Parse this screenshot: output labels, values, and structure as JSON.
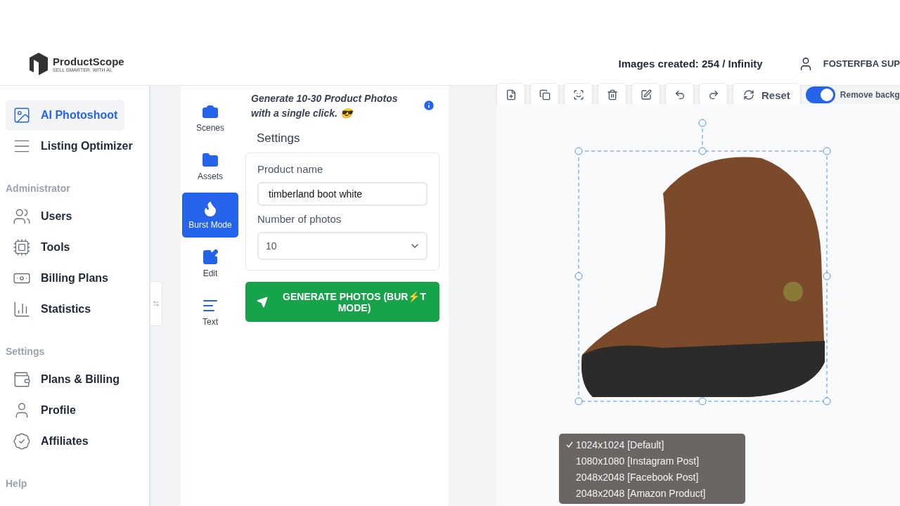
{
  "logo": {
    "name": "ProductScope",
    "tagline": "SELL SMARTER. WITH AI."
  },
  "header": {
    "usage": "Images created: 254 / Infinity",
    "user": "FOSTERFBA SUP"
  },
  "sidebar": {
    "groups": [
      {
        "items": [
          {
            "label": "AI Photoshoot",
            "selected": true
          },
          {
            "label": "Listing Optimizer",
            "selected": false
          }
        ]
      },
      {
        "heading": "Administrator",
        "items": [
          {
            "label": "Users",
            "selected": false
          },
          {
            "label": "Tools",
            "selected": false
          },
          {
            "label": "Billing Plans",
            "selected": false
          },
          {
            "label": "Statistics",
            "selected": false
          }
        ]
      },
      {
        "heading": "Settings",
        "items": [
          {
            "label": "Plans & Billing",
            "selected": false
          },
          {
            "label": "Profile",
            "selected": false
          },
          {
            "label": "Affiliates",
            "selected": false
          }
        ]
      },
      {
        "heading": "Help"
      }
    ]
  },
  "tools": [
    {
      "label": "Scenes",
      "selected": false
    },
    {
      "label": "Assets",
      "selected": false
    },
    {
      "label": "Burst Mode",
      "selected": true
    },
    {
      "label": "Edit",
      "selected": false
    },
    {
      "label": "Text",
      "selected": false
    }
  ],
  "burst": {
    "intro": "Generate 10-30 Product Photos with a single click. 😎",
    "settings_title": "Settings",
    "product_label": "Product name",
    "product_value": "timberland boot white",
    "count_label": "Number of photos",
    "count_value": "10",
    "generate": "GENERATE PHOTOS (BUR⚡T MODE)"
  },
  "toolbar": {
    "buttons": [
      {
        "kind": "icon"
      },
      {
        "kind": "icon"
      },
      {
        "kind": "icon"
      },
      {
        "kind": "icon"
      },
      {
        "kind": "icon"
      },
      {
        "kind": "icon"
      },
      {
        "kind": "icon"
      },
      {
        "kind": "text",
        "label": "Reset"
      }
    ],
    "remove_background": {
      "label": "Remove backg",
      "on": true
    }
  },
  "size_menu": [
    {
      "label": "1024x1024 [Default]",
      "selected": true
    },
    {
      "label": "1080x1080 [Instagram Post]",
      "selected": false
    },
    {
      "label": "2048x2048 [Facebook Post]",
      "selected": false
    },
    {
      "label": "2048x2048 [Amazon Product]",
      "selected": false
    }
  ]
}
